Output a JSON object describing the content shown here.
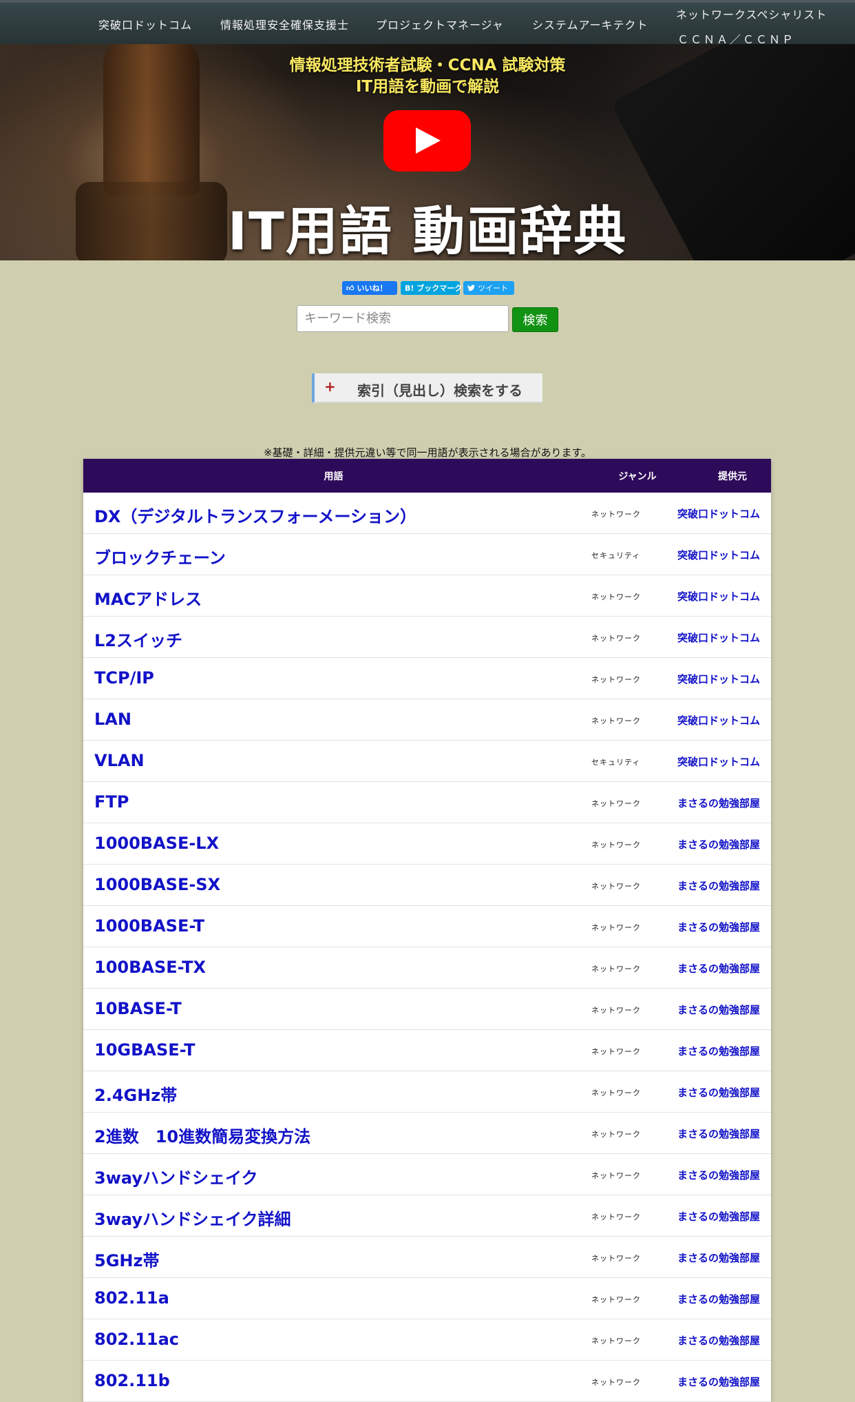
{
  "nav": {
    "items": [
      {
        "label": "突破口ドットコム"
      },
      {
        "label": "情報処理安全確保支援士"
      },
      {
        "label": "プロジェクトマネージャ"
      },
      {
        "label": "システムアーキテクト"
      },
      {
        "label": "ネットワークスペシャリスト"
      },
      {
        "label": "ＣＣＮＡ／ＣＣＮＰ"
      }
    ]
  },
  "hero": {
    "subtitle_line1": "情報処理技術者試験・CCNA 試験対策",
    "subtitle_line2": "IT用語を動画で解説",
    "title": "IT用語 動画辞典",
    "play_icon": "youtube-play-icon"
  },
  "share": {
    "like_label": "いいね！",
    "hatena_label": "B! ブックマーク",
    "tweet_label": "ツイート"
  },
  "search": {
    "placeholder": "キーワード検索",
    "value": "",
    "button_label": "検索"
  },
  "index_toggle": {
    "icon": "+",
    "label": "索引（見出し）検索をする"
  },
  "notice": "※基礎・詳細・提供元違い等で同一用語が表示される場合があります。",
  "table": {
    "headers": {
      "term": "用語",
      "genre": "ジャンル",
      "source": "提供元"
    },
    "rows": [
      {
        "term": "DX（デジタルトランスフォーメーション）",
        "genre": "ネットワーク",
        "source": "突破口ドットコム"
      },
      {
        "term": "ブロックチェーン",
        "genre": "セキュリティ",
        "source": "突破口ドットコム"
      },
      {
        "term": "MACアドレス",
        "genre": "ネットワーク",
        "source": "突破口ドットコム"
      },
      {
        "term": "L2スイッチ",
        "genre": "ネットワーク",
        "source": "突破口ドットコム"
      },
      {
        "term": "TCP/IP",
        "genre": "ネットワーク",
        "source": "突破口ドットコム"
      },
      {
        "term": "LAN",
        "genre": "ネットワーク",
        "source": "突破口ドットコム"
      },
      {
        "term": "VLAN",
        "genre": "セキュリティ",
        "source": "突破口ドットコム"
      },
      {
        "term": "FTP",
        "genre": "ネットワーク",
        "source": "まさるの勉強部屋"
      },
      {
        "term": "1000BASE-LX",
        "genre": "ネットワーク",
        "source": "まさるの勉強部屋"
      },
      {
        "term": "1000BASE-SX",
        "genre": "ネットワーク",
        "source": "まさるの勉強部屋"
      },
      {
        "term": "1000BASE-T",
        "genre": "ネットワーク",
        "source": "まさるの勉強部屋"
      },
      {
        "term": "100BASE-TX",
        "genre": "ネットワーク",
        "source": "まさるの勉強部屋"
      },
      {
        "term": "10BASE-T",
        "genre": "ネットワーク",
        "source": "まさるの勉強部屋"
      },
      {
        "term": "10GBASE-T",
        "genre": "ネットワーク",
        "source": "まさるの勉強部屋"
      },
      {
        "term": "2.4GHz帯",
        "genre": "ネットワーク",
        "source": "まさるの勉強部屋"
      },
      {
        "term": "2進数　10進数簡易変換方法",
        "genre": "ネットワーク",
        "source": "まさるの勉強部屋"
      },
      {
        "term": "3wayハンドシェイク",
        "genre": "ネットワーク",
        "source": "まさるの勉強部屋"
      },
      {
        "term": "3wayハンドシェイク詳細",
        "genre": "ネットワーク",
        "source": "まさるの勉強部屋"
      },
      {
        "term": "5GHz帯",
        "genre": "ネットワーク",
        "source": "まさるの勉強部屋"
      },
      {
        "term": "802.11a",
        "genre": "ネットワーク",
        "source": "まさるの勉強部屋"
      },
      {
        "term": "802.11ac",
        "genre": "ネットワーク",
        "source": "まさるの勉強部屋"
      },
      {
        "term": "802.11b",
        "genre": "ネットワーク",
        "source": "まさるの勉強部屋"
      }
    ]
  },
  "colors": {
    "page_bg": "#cfcfb0",
    "nav_bg": "#2f3b3d",
    "table_header_bg": "#2e0a5a",
    "link": "#1212c8",
    "search_button": "#129212",
    "hero_subtitle": "#f8e860",
    "youtube_red": "#ff0000"
  }
}
